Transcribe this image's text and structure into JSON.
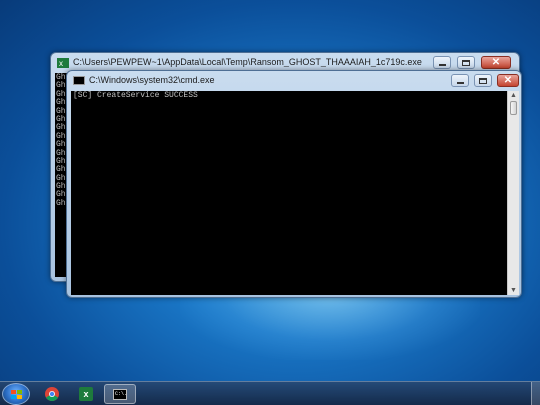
{
  "back_window": {
    "title": "C:\\Users\\PEWPEW~1\\AppData\\Local\\Temp\\Ransom_GHOST_THAAAIAH_1c719c.exe",
    "line_text": "Gh",
    "line_count": 16
  },
  "front_window": {
    "title": "C:\\Windows\\system32\\cmd.exe",
    "console_text": "[SC] CreateService SUCCESS"
  },
  "controls": {
    "close_glyph": "✕"
  },
  "taskbar": {
    "items": [
      {
        "name": "chrome",
        "icon": "chrome-icon"
      },
      {
        "name": "excel-ghost",
        "icon": "excel-app-icon"
      },
      {
        "name": "cmd",
        "icon": "cmd-icon",
        "label": "C:\\.",
        "active": true
      }
    ]
  }
}
